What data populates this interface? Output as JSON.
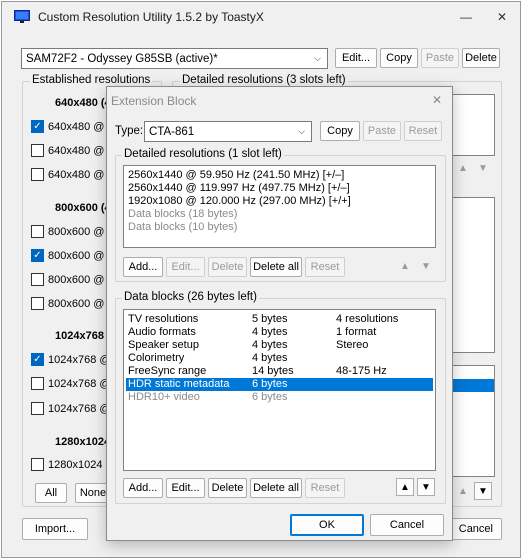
{
  "main": {
    "title": "Custom Resolution Utility 1.5.2 by ToastyX",
    "minimize": "—",
    "close": "✕",
    "monitor": "SAM72F2 - Odyssey G85SB (active)*",
    "edit_label": "Edit...",
    "copy_label": "Copy",
    "paste_label": "Paste",
    "delete_label": "Delete",
    "established_label": "Established resolutions",
    "detailed_label": "Detailed resolutions (3 slots left)",
    "groups": [
      {
        "heading": "640x480 (4",
        "items": [
          {
            "label": "640x480 @ 6",
            "checked": true
          },
          {
            "label": "640x480 @ 7",
            "checked": false
          },
          {
            "label": "640x480 @ 7",
            "checked": false
          }
        ]
      },
      {
        "heading": "800x600 (4",
        "items": [
          {
            "label": "800x600 @ 5",
            "checked": false
          },
          {
            "label": "800x600 @ 6",
            "checked": true
          },
          {
            "label": "800x600 @ 7",
            "checked": false
          },
          {
            "label": "800x600 @ 7",
            "checked": false
          }
        ]
      },
      {
        "heading": "1024x768",
        "items": [
          {
            "label": "1024x768 @",
            "checked": true
          },
          {
            "label": "1024x768 @",
            "checked": false
          },
          {
            "label": "1024x768 @",
            "checked": false
          }
        ]
      },
      {
        "heading": "1280x1024",
        "items": [
          {
            "label": "1280x1024 (",
            "checked": false
          }
        ]
      }
    ],
    "all_label": "All",
    "none_label": "None",
    "import_label": "Import...",
    "cancel_label": "Cancel",
    "up": "▲",
    "down": "▼"
  },
  "dialog": {
    "title": "Extension Block",
    "close": "✕",
    "type_label": "Type:",
    "type_value": "CTA-861",
    "copy_label": "Copy",
    "paste_label": "Paste",
    "reset_label": "Reset",
    "detailed_label": "Detailed resolutions (1 slot left)",
    "detailed_rows": [
      {
        "text": "2560x1440 @ 59.950 Hz (241.50 MHz) [+/–]",
        "gray": false
      },
      {
        "text": "2560x1440 @ 119.997 Hz (497.75 MHz) [+/–]",
        "gray": false
      },
      {
        "text": "1920x1080 @ 120.000 Hz (297.00 MHz) [+/+]",
        "gray": false
      },
      {
        "text": "Data blocks (18 bytes)",
        "gray": true
      },
      {
        "text": "Data blocks (10 bytes)",
        "gray": true
      }
    ],
    "add_label": "Add...",
    "edit_label": "Edit...",
    "delete_label": "Delete",
    "delete_all_label": "Delete all",
    "data_blocks_label": "Data blocks (26 bytes left)",
    "data_rows": [
      {
        "name": "TV resolutions",
        "size": "5 bytes",
        "info": "4 resolutions",
        "selected": false,
        "gray": false
      },
      {
        "name": "Audio formats",
        "size": "4 bytes",
        "info": "1 format",
        "selected": false,
        "gray": false
      },
      {
        "name": "Speaker setup",
        "size": "4 bytes",
        "info": "Stereo",
        "selected": false,
        "gray": false
      },
      {
        "name": "Colorimetry",
        "size": "4 bytes",
        "info": "",
        "selected": false,
        "gray": false
      },
      {
        "name": "FreeSync range",
        "size": "14 bytes",
        "info": "48-175 Hz",
        "selected": false,
        "gray": false
      },
      {
        "name": "HDR static metadata",
        "size": "6 bytes",
        "info": "",
        "selected": true,
        "gray": false
      },
      {
        "name": "HDR10+ video",
        "size": "6 bytes",
        "info": "",
        "selected": false,
        "gray": true
      }
    ],
    "ok_label": "OK",
    "cancel_label": "Cancel",
    "up": "▲",
    "down": "▼"
  },
  "colors": {
    "accent": "#0078d7",
    "selection": "#0078d7",
    "check": "#0067c0",
    "window_bg": "#f0f0f0"
  }
}
